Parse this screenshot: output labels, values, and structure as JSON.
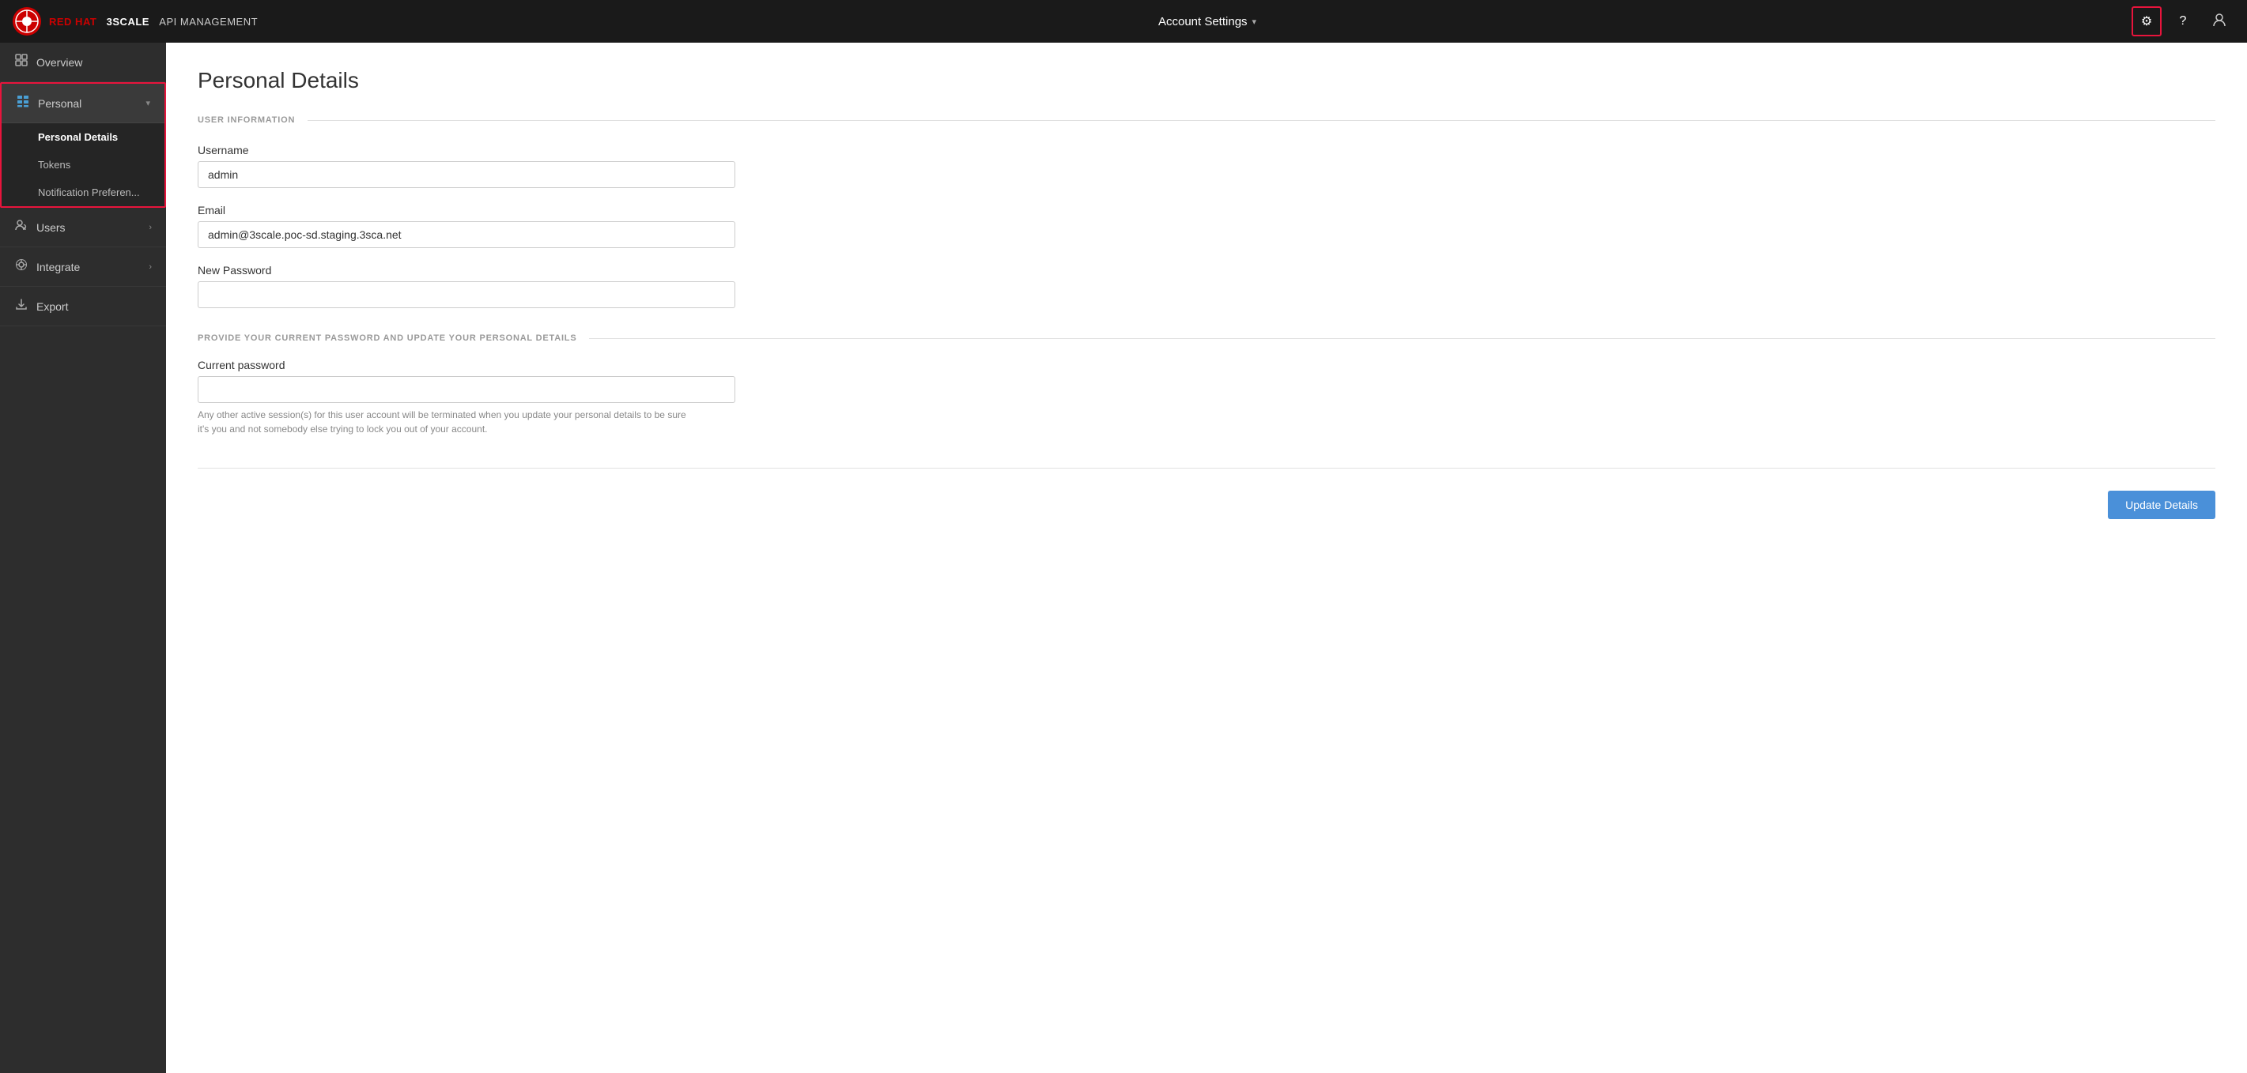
{
  "brand": {
    "logo_alt": "Red Hat 3scale logo",
    "name_part1": "RED HAT",
    "name_part2": "3SCALE",
    "name_part3": "API MANAGEMENT"
  },
  "topnav": {
    "dropdown_label": "Account Settings",
    "gear_icon": "⚙",
    "help_icon": "?",
    "user_icon": "👤"
  },
  "sidebar": {
    "items": [
      {
        "id": "overview",
        "label": "Overview",
        "icon": "🗺",
        "has_arrow": false
      },
      {
        "id": "personal",
        "label": "Personal",
        "icon": "▦",
        "has_arrow": true,
        "active": true,
        "subitems": [
          {
            "id": "personal-details",
            "label": "Personal Details",
            "active": true
          },
          {
            "id": "tokens",
            "label": "Tokens",
            "active": false
          },
          {
            "id": "notification-preferences",
            "label": "Notification Preferen...",
            "active": false
          }
        ]
      },
      {
        "id": "users",
        "label": "Users",
        "icon": "👥",
        "has_arrow": true
      },
      {
        "id": "integrate",
        "label": "Integrate",
        "icon": "⚙",
        "has_arrow": true
      },
      {
        "id": "export",
        "label": "Export",
        "icon": "⬇",
        "has_arrow": false
      }
    ]
  },
  "main": {
    "page_title": "Personal Details",
    "section1": {
      "label": "USER INFORMATION"
    },
    "fields": {
      "username_label": "Username",
      "username_value": "admin",
      "email_label": "Email",
      "email_value": "admin@3scale.poc-sd.staging.3sca.net",
      "new_password_label": "New Password",
      "new_password_value": ""
    },
    "section2": {
      "label": "PROVIDE YOUR CURRENT PASSWORD AND UPDATE YOUR PERSONAL DETAILS"
    },
    "current_password": {
      "label": "Current password",
      "value": "",
      "help_text": "Any other active session(s) for this user account will be terminated when you update your personal details to be sure it's you and not somebody else trying to lock you out of your account."
    },
    "update_button_label": "Update Details"
  }
}
